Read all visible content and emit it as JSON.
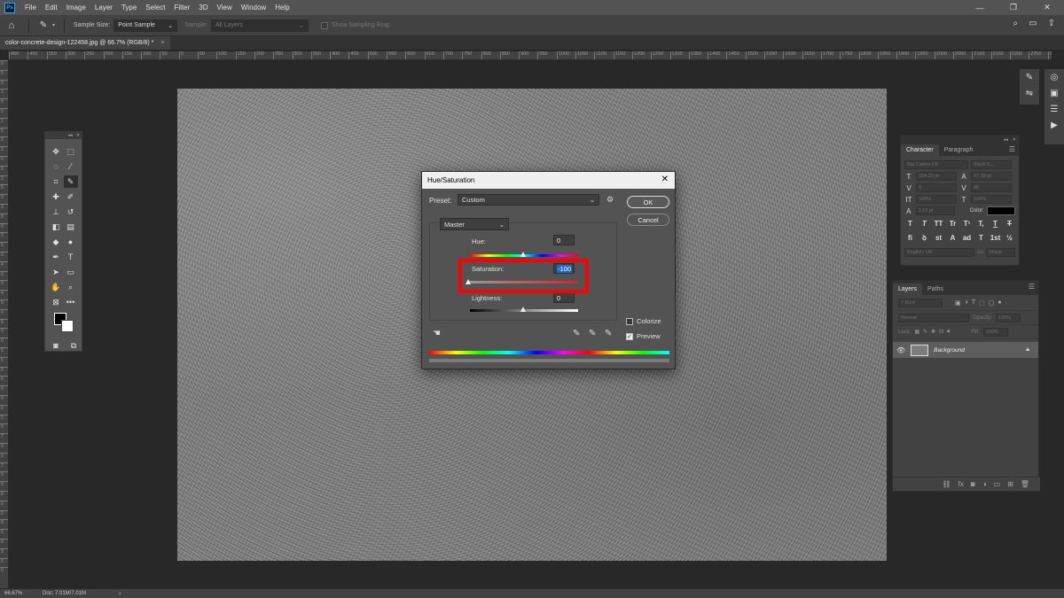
{
  "menubar": {
    "logo": "Ps",
    "items": [
      "File",
      "Edit",
      "Image",
      "Layer",
      "Type",
      "Select",
      "Filter",
      "3D",
      "View",
      "Window",
      "Help"
    ]
  },
  "options": {
    "sample_size_label": "Sample Size:",
    "sample_size_value": "Point Sample",
    "sample_label": "Sample:",
    "sample_value": "All Layers",
    "sampling_ring_label": "Show Sampling Ring"
  },
  "document": {
    "tab_title": "color-concrete-design-122458.jpg @ 66.7% (RGB/8) *",
    "close": "×"
  },
  "ruler": {
    "h_ticks": [
      "450",
      "400",
      "350",
      "300",
      "250",
      "200",
      "150",
      "100",
      "50",
      "0",
      "50",
      "100",
      "150",
      "200",
      "250",
      "300",
      "350",
      "400",
      "450",
      "500",
      "550",
      "600",
      "650",
      "700",
      "750",
      "800",
      "850",
      "900",
      "950",
      "1000",
      "1050",
      "1100",
      "1150",
      "1200",
      "1250",
      "1300",
      "1350",
      "1400",
      "1450",
      "1500",
      "1550",
      "1600",
      "1650",
      "1700",
      "1750",
      "1800",
      "1850",
      "1900",
      "1950",
      "2000",
      "2050",
      "2100",
      "2150",
      "2200",
      "2250",
      "2300",
      "2350"
    ],
    "v_ticks": [
      "0",
      "5",
      "0",
      "1",
      "0",
      "0",
      "1",
      "5",
      "0",
      "2",
      "0",
      "0",
      "2",
      "5",
      "0",
      "3",
      "0",
      "0",
      "3",
      "5",
      "0",
      "4",
      "0",
      "0",
      "4",
      "5",
      "0",
      "5",
      "0",
      "0",
      "5",
      "5",
      "0",
      "6",
      "0",
      "0",
      "6",
      "5",
      "0",
      "7",
      "0",
      "0",
      "7",
      "5",
      "0",
      "8",
      "0",
      "0",
      "8",
      "5",
      "0",
      "9",
      "0",
      "0"
    ]
  },
  "character_panel": {
    "tabs": [
      "Character",
      "Paragraph"
    ],
    "font_family": "Big Caslon FB",
    "font_style": "Black S...",
    "font_size": "154.29 pt",
    "leading": "97.38 pt",
    "kerning": "0",
    "tracking": "40",
    "vertical_scale": "100%",
    "horizontal_scale": "100%",
    "baseline_shift": "1.13 pt",
    "color_label": "Color:",
    "language": "English: UK",
    "aa_method": "Sharp",
    "style_buttons": [
      "T",
      "T",
      "TT",
      "Tr",
      "T¹",
      "T,",
      "T",
      "T"
    ],
    "opentype_buttons": [
      "fi",
      "ꝺ",
      "st",
      "A",
      "ad",
      "T",
      "1st",
      "½"
    ]
  },
  "layers_panel": {
    "tabs": [
      "Layers",
      "Paths"
    ],
    "filter_kind": "Kind",
    "blend_mode": "Normal",
    "opacity_label": "Opacity:",
    "opacity_value": "100%",
    "lock_label": "Lock:",
    "fill_label": "Fill:",
    "fill_value": "100%",
    "layer_name": "Background"
  },
  "status": {
    "zoom": "66.67%",
    "doc": "Doc: 7.01M/7.01M"
  },
  "dialog": {
    "title": "Hue/Saturation",
    "close": "✕",
    "preset_label": "Preset:",
    "preset_value": "Custom",
    "ok_label": "OK",
    "cancel_label": "Cancel",
    "channel": "Master",
    "hue_label": "Hue:",
    "hue_value": "0",
    "saturation_label": "Saturation:",
    "saturation_value": "-100",
    "lightness_label": "Lightness:",
    "lightness_value": "0",
    "colorize_label": "Colorize",
    "colorize_checked": false,
    "preview_label": "Preview",
    "preview_checked": true
  },
  "colors": {
    "highlight": "#ff0000",
    "foreground": "#000000",
    "background": "#ffffff",
    "selection": "#1b6bcc"
  }
}
